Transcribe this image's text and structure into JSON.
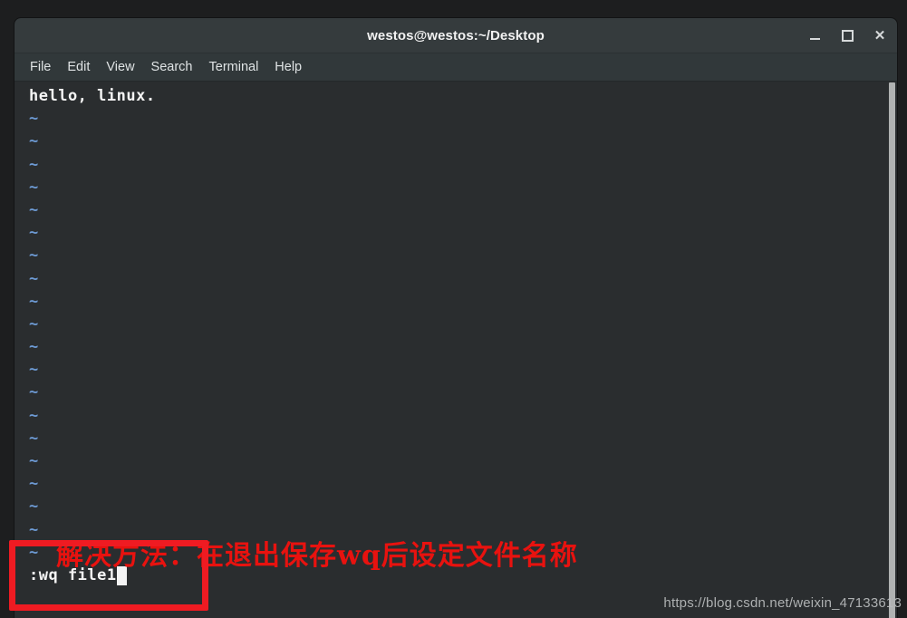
{
  "window": {
    "title": "westos@westos:~/Desktop",
    "controls": [
      {
        "name": "minimize-button",
        "label": "–"
      },
      {
        "name": "maximize-button",
        "label": "□"
      },
      {
        "name": "close-button",
        "label": "×"
      }
    ]
  },
  "menubar": {
    "items": [
      {
        "label": "File"
      },
      {
        "label": "Edit"
      },
      {
        "label": "View"
      },
      {
        "label": "Search"
      },
      {
        "label": "Terminal"
      },
      {
        "label": "Help"
      }
    ]
  },
  "terminal": {
    "file_text": "hello, linux.",
    "tilde": "~",
    "tilde_count_before_box": 18,
    "tilde_count_in_box": 2,
    "command_line": ":wq file1",
    "cursor": "block"
  },
  "annotation": {
    "note_text": "解决方法：在退出保存wq后设定文件名称",
    "note_color": "#e8120f",
    "box_color": "#ef1b22"
  },
  "watermark": {
    "text": "https://blog.csdn.net/weixin_47133613"
  },
  "colors": {
    "titlebar": "#353b3d",
    "menubar": "#31383a",
    "terminal_bg": "#2a2d2f",
    "terminal_fg": "#f4f4f4",
    "tilde_blue": "#6d9ad4",
    "desktop_bg": "#1d1e1f"
  }
}
